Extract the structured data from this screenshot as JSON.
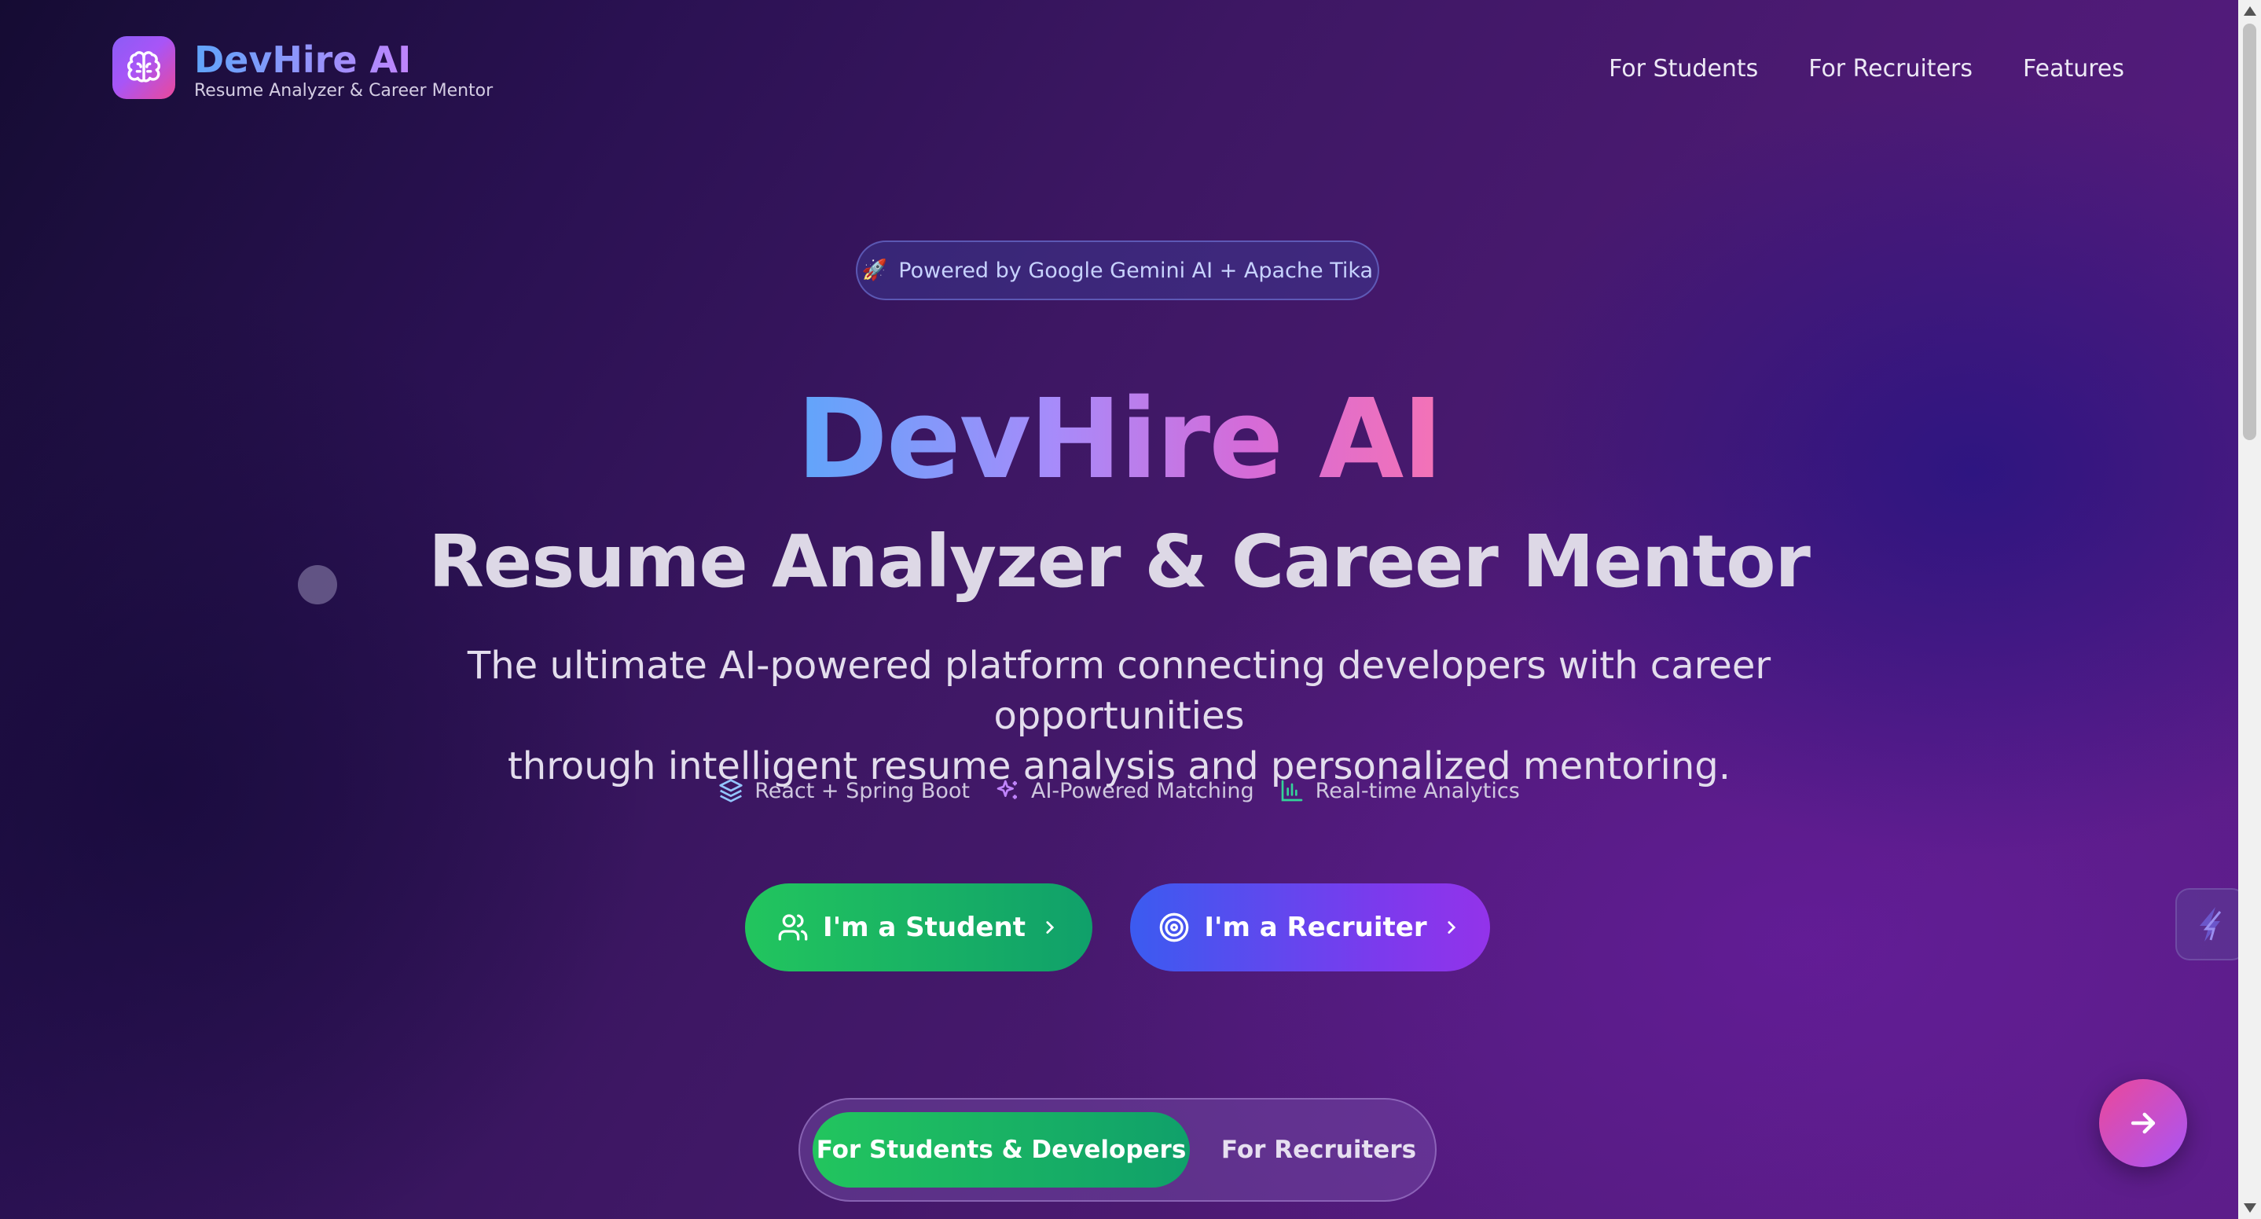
{
  "header": {
    "brand_name": "DevHire AI",
    "brand_subtitle": "Resume Analyzer & Career Mentor",
    "logo_icon": "brain-icon",
    "nav": [
      "For Students",
      "For Recruiters",
      "Features"
    ]
  },
  "hero": {
    "badge_icon": "rocket-icon",
    "badge_text": "Powered by Google Gemini AI + Apache Tika",
    "title": "DevHire AI",
    "subtitle": "Resume Analyzer & Career Mentor",
    "description_line1": "The ultimate AI-powered platform connecting developers with career opportunities",
    "description_line2": "through intelligent resume analysis and personalized mentoring.",
    "features": [
      {
        "icon": "layers-icon",
        "label": "React + Spring Boot"
      },
      {
        "icon": "sparkles-icon",
        "label": "AI-Powered Matching"
      },
      {
        "icon": "bar-chart-icon",
        "label": "Real-time Analytics"
      }
    ]
  },
  "cta": {
    "student_label": "I'm a Student",
    "recruiter_label": "I'm a Recruiter"
  },
  "toggle": {
    "active_label": "For Students & Developers",
    "inactive_label": "For Recruiters"
  },
  "colors": {
    "student_green": "#22c55e",
    "recruiter_blue": "#3b5bf0",
    "recruiter_purple": "#9333ea",
    "accent_pink": "#ec4899",
    "title_blue": "#60a5fa"
  }
}
